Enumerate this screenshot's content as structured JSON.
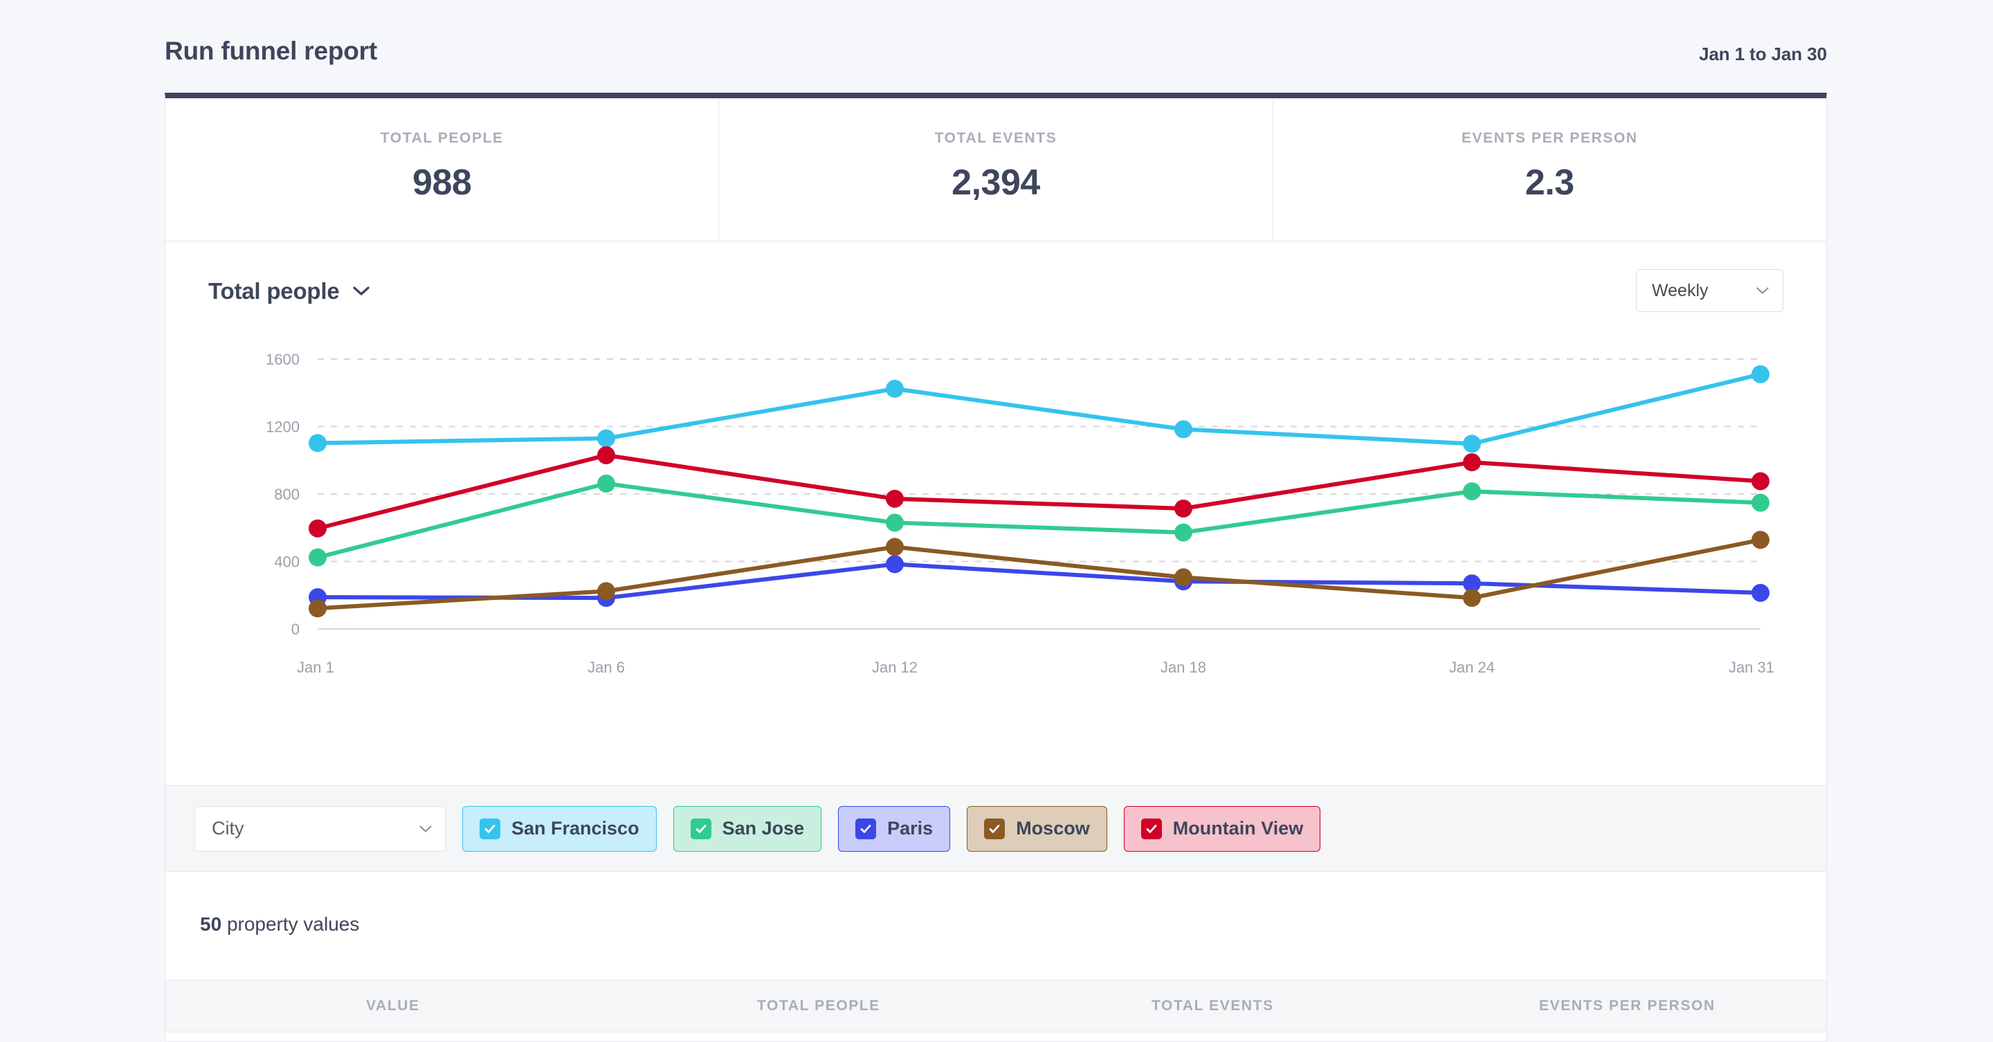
{
  "header": {
    "title": "Run funnel report",
    "date_range": "Jan 1 to Jan 30"
  },
  "stats": [
    {
      "label": "TOTAL PEOPLE",
      "value": "988"
    },
    {
      "label": "TOTAL EVENTS",
      "value": "2,394"
    },
    {
      "label": "EVENTS PER PERSON",
      "value": "2.3"
    }
  ],
  "chart_toolbar": {
    "metric_label": "Total people",
    "granularity_label": "Weekly"
  },
  "filter_bar": {
    "property_label": "City",
    "chips": [
      {
        "label": "San Francisco",
        "color": "#35c3ec",
        "bg": "#c7eef9",
        "checked": true
      },
      {
        "label": "San Jose",
        "color": "#32cb8f",
        "bg": "#c9f0df",
        "checked": true
      },
      {
        "label": "Paris",
        "color": "#3b47e8",
        "bg": "#c8cdfb",
        "checked": true
      },
      {
        "label": "Moscow",
        "color": "#8a5a22",
        "bg": "#ddcdb9",
        "checked": true
      },
      {
        "label": "Mountain View",
        "color": "#d10028",
        "bg": "#f6c2cc",
        "checked": true
      }
    ]
  },
  "table": {
    "count": "50",
    "count_word": "property values",
    "columns": [
      "VALUE",
      "TOTAL PEOPLE",
      "TOTAL EVENTS",
      "EVENTS PER PERSON"
    ]
  },
  "chart_data": {
    "type": "line",
    "title": "Total people",
    "xlabel": "",
    "ylabel": "",
    "grid": true,
    "legend_position": "bottom",
    "x": [
      "Jan 1",
      "Jan 6",
      "Jan 12",
      "Jan 18",
      "Jan 24",
      "Jan 31"
    ],
    "xtick_labels": [
      "Jan 1",
      "Jan 6",
      "Jan 12",
      "Jan 18",
      "Jan 24",
      "Jan 31"
    ],
    "ytick_labels": [
      "0",
      "400",
      "800",
      "1200",
      "1600"
    ],
    "yticks": [
      0,
      400,
      800,
      1200,
      1600
    ],
    "ylim": [
      0,
      1600
    ],
    "series": [
      {
        "name": "San Francisco",
        "color": "#35c3ec",
        "values": [
          1102,
          1130,
          1424,
          1184,
          1098,
          1510
        ]
      },
      {
        "name": "Mountain View",
        "color": "#d10028",
        "values": [
          596,
          1030,
          772,
          714,
          988,
          876
        ]
      },
      {
        "name": "San Jose",
        "color": "#32cb8f",
        "values": [
          424,
          862,
          630,
          572,
          816,
          748
        ]
      },
      {
        "name": "Paris",
        "color": "#3b47e8",
        "values": [
          188,
          184,
          384,
          282,
          270,
          214
        ]
      },
      {
        "name": "Moscow",
        "color": "#8a5a22",
        "values": [
          122,
          224,
          486,
          306,
          184,
          528
        ]
      }
    ]
  }
}
